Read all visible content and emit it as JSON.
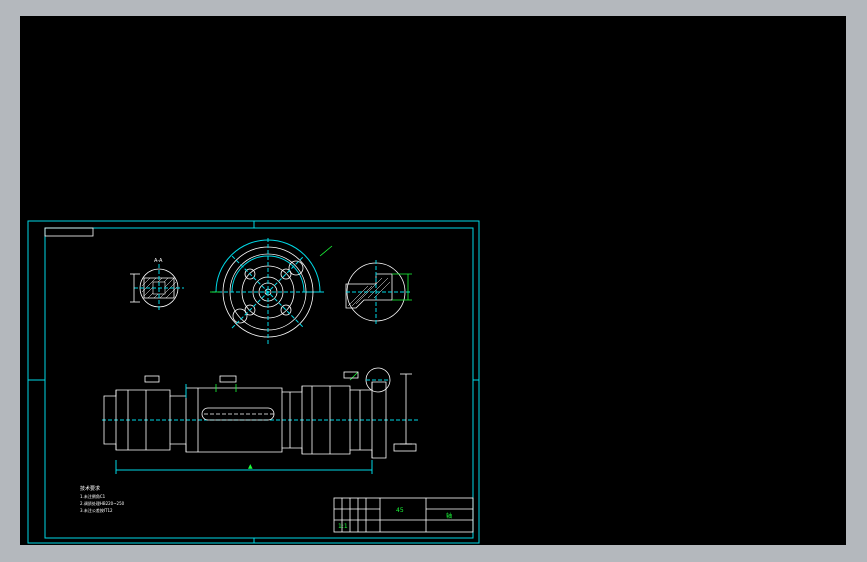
{
  "colors": {
    "window_frame": "#b4b8bd",
    "canvas": "#000000",
    "border_line": "#00d9e6",
    "geometry_line": "#ffffff",
    "annotation_line": "#1aff3a"
  },
  "drawing": {
    "section_label": "A-A",
    "notes": {
      "heading": "技术要求",
      "lines": [
        "1.未注倒角C1",
        "2.调质处理HB220~250",
        "3.未注公差按IT12"
      ]
    },
    "title_block": {
      "part_name": "轴",
      "scale": "1:1",
      "material": "45"
    }
  }
}
